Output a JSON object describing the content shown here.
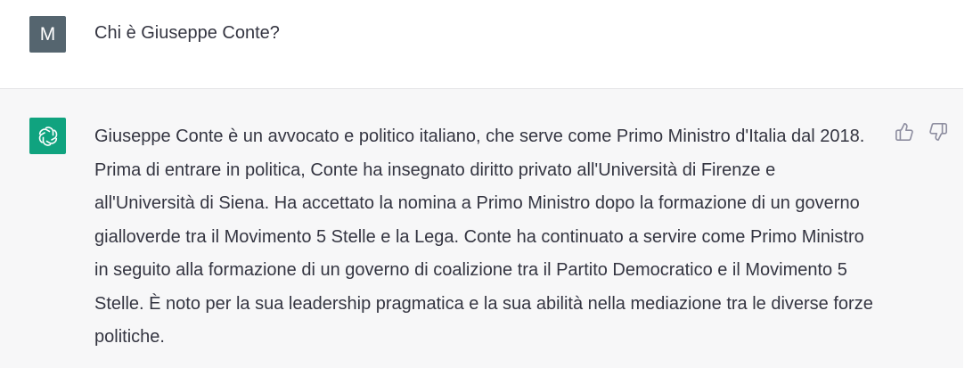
{
  "user": {
    "avatar_letter": "M",
    "message": "Chi è Giuseppe Conte?"
  },
  "assistant": {
    "message": "Giuseppe Conte è un avvocato e politico italiano, che serve come Primo Ministro d'Italia dal 2018. Prima di entrare in politica, Conte ha insegnato diritto privato all'Università di Firenze e all'Università di Siena. Ha accettato la nomina a Primo Ministro dopo la formazione di un governo gialloverde tra il Movimento 5 Stelle e la Lega. Conte ha continuato a servire come Primo Ministro in seguito alla formazione di un governo di coalizione tra il Partito Democratico e il Movimento 5 Stelle. È noto per la sua leadership pragmatica e la sua abilità nella mediazione tra le diverse forze politiche."
  },
  "icons": {
    "assistant_avatar": "openai-logo-icon",
    "like": "thumbs-up-icon",
    "dislike": "thumbs-down-icon"
  },
  "colors": {
    "user_avatar_bg": "#55656f",
    "assistant_avatar_bg": "#10a37f",
    "assistant_row_bg": "#f7f7f8",
    "text": "#343541",
    "icon": "#8e8ea0"
  }
}
